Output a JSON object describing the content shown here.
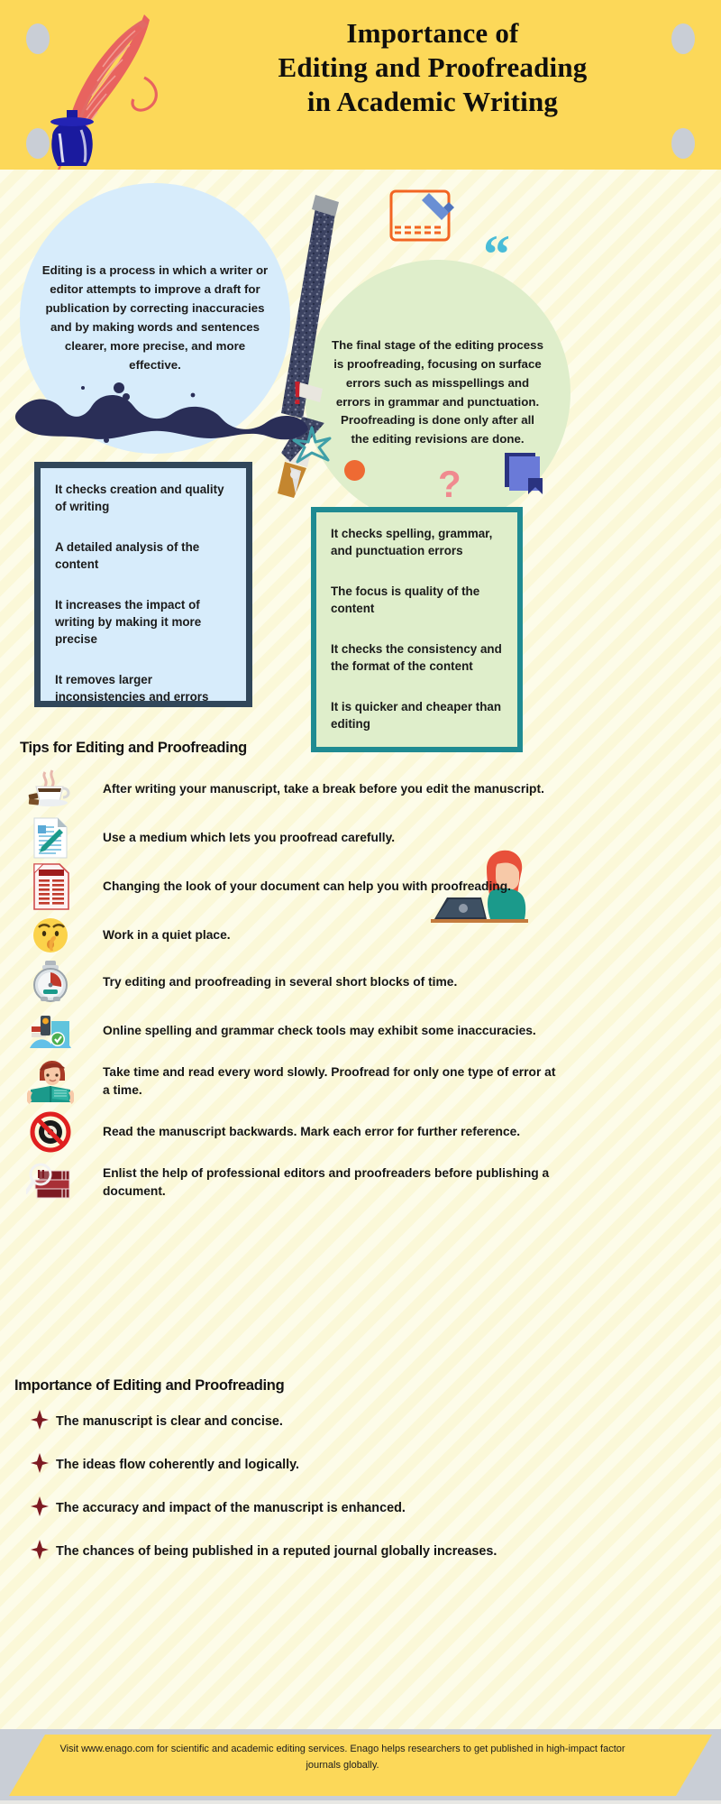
{
  "header": {
    "title_line1": "Importance of",
    "title_line2": "Editing and Proofreading",
    "title_line3": "in Academic Writing",
    "bg_color": "#fcd859",
    "quill_color": "#e8635f",
    "inkpot_color": "#1a1a9e"
  },
  "circles": {
    "editing": {
      "text": "Editing is a process in which a writer or editor attempts to improve a draft for publication by correcting inaccuracies  and by making words and sentences clearer, more precise, and more effective.",
      "bg_color": "#d7ecfb"
    },
    "proofreading": {
      "text": "The final stage of the editing process is proofreading, focusing on surface errors such as misspellings and errors in grammar and punctuation. Proofreading is done only after all the editing revisions are done.",
      "bg_color": "#dfeecb"
    }
  },
  "decorations": {
    "exclamation": "!",
    "question": "?",
    "quote_mark": "“",
    "border_blue": "#31475a",
    "border_green": "#1f8b92",
    "orange_dot": "#ee6a33",
    "teal_star": "#3f9fa8"
  },
  "editing_box": {
    "items": [
      " It checks creation and quality of writing",
      "A detailed analysis of the content",
      "It increases the impact of writing by making it more precise",
      "It removes larger inconsistencies and errors"
    ]
  },
  "proofreading_box": {
    "items": [
      "It checks spelling, grammar, and punctuation errors",
      "The focus is quality of the content",
      "It checks  the consistency and the format of the content",
      "It is quicker and cheaper than editing"
    ]
  },
  "tips_section": {
    "heading": "Tips for Editing and Proofreading",
    "items": [
      {
        "icon": "coffee-cup-icon",
        "text": "After writing your manuscript, take a break before you edit the manuscript."
      },
      {
        "icon": "document-pen-icon",
        "text": "Use a medium which lets you proofread carefully."
      },
      {
        "icon": "red-document-icon",
        "text": "Changing the look of your document can help you with proofreading."
      },
      {
        "icon": "quiet-face-icon",
        "text": "Work in a quiet place."
      },
      {
        "icon": "stopwatch-icon",
        "text": "Try editing and proofreading in several short blocks of time."
      },
      {
        "icon": "online-check-icon",
        "text": " Online spelling and grammar check tools may exhibit some inaccuracies."
      },
      {
        "icon": "girl-reading-icon",
        "text": "Take time and read every word slowly. Proofread for only one type of error at a time."
      },
      {
        "icon": "no-entry-icon",
        "text": "Read the manuscript backwards. Mark each error for further reference."
      },
      {
        "icon": "books-magnifier-icon",
        "text": "Enlist the help of professional editors and proofreaders before publishing a document."
      }
    ]
  },
  "importance_section": {
    "heading": "Importance of Editing and Proofreading",
    "bullet": "✦",
    "bullet_color": "#7d1a22",
    "items": [
      "The manuscript is clear and concise.",
      "The ideas flow coherently and logically.",
      "The accuracy and impact of the manuscript is enhanced.",
      "The chances of being published in a reputed journal globally increases."
    ]
  },
  "footer": {
    "text": "Visit www.enago.com for scientific and academic editing services. Enago helps researchers to get published in high-impact factor journals globally.",
    "band_color": "#fcd859",
    "bg_color": "#c9ced6"
  }
}
